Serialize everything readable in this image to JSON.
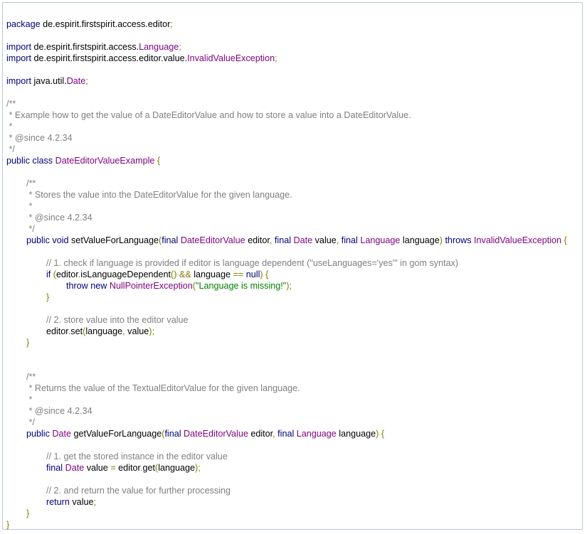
{
  "code_lines": [
    [
      [
        "kw",
        "package"
      ],
      [
        "pl",
        " de.espirit.firstspirit.access.editor"
      ],
      [
        "op",
        ";"
      ]
    ],
    [],
    [
      [
        "kw",
        "import"
      ],
      [
        "pl",
        " de.espirit.firstspirit.access."
      ],
      [
        "ty",
        "Language"
      ],
      [
        "op",
        ";"
      ]
    ],
    [
      [
        "kw",
        "import"
      ],
      [
        "pl",
        " de.espirit.firstspirit.access.editor.value."
      ],
      [
        "ty",
        "InvalidValueException"
      ],
      [
        "op",
        ";"
      ]
    ],
    [],
    [
      [
        "kw",
        "import"
      ],
      [
        "pl",
        " java.util."
      ],
      [
        "ty",
        "Date"
      ],
      [
        "op",
        ";"
      ]
    ],
    [],
    [
      [
        "cm",
        "/**"
      ]
    ],
    [
      [
        "cm",
        " * Example how to get the value of a DateEditorValue and how to store a value into a DateEditorValue."
      ]
    ],
    [
      [
        "cm",
        " *"
      ]
    ],
    [
      [
        "cm",
        " * @since 4.2.34"
      ]
    ],
    [
      [
        "cm",
        " */"
      ]
    ],
    [
      [
        "kw",
        "public class"
      ],
      [
        "pl",
        " "
      ],
      [
        "ty",
        "DateEditorValueExample"
      ],
      [
        "op",
        " {"
      ]
    ],
    [],
    [
      [
        "pl",
        "        "
      ],
      [
        "cm",
        "/**"
      ]
    ],
    [
      [
        "pl",
        "        "
      ],
      [
        "cm",
        " * Stores the value into the DateEditorValue for the given language."
      ]
    ],
    [
      [
        "pl",
        "        "
      ],
      [
        "cm",
        " *"
      ]
    ],
    [
      [
        "pl",
        "        "
      ],
      [
        "cm",
        " * @since 4.2.34"
      ]
    ],
    [
      [
        "pl",
        "        "
      ],
      [
        "cm",
        " */"
      ]
    ],
    [
      [
        "pl",
        "        "
      ],
      [
        "kw",
        "public void"
      ],
      [
        "pl",
        " setValueForLanguage"
      ],
      [
        "op",
        "("
      ],
      [
        "kw",
        "final"
      ],
      [
        "pl",
        " "
      ],
      [
        "ty",
        "DateEditorValue"
      ],
      [
        "pl",
        " editor"
      ],
      [
        "op",
        ", "
      ],
      [
        "kw",
        "final"
      ],
      [
        "pl",
        " "
      ],
      [
        "ty",
        "Date"
      ],
      [
        "pl",
        " value"
      ],
      [
        "op",
        ", "
      ],
      [
        "kw",
        "final"
      ],
      [
        "pl",
        " "
      ],
      [
        "ty",
        "Language"
      ],
      [
        "pl",
        " language"
      ],
      [
        "op",
        ") "
      ],
      [
        "kw",
        "throws"
      ],
      [
        "pl",
        " "
      ],
      [
        "ty",
        "InvalidValueException"
      ],
      [
        "op",
        " {"
      ]
    ],
    [],
    [
      [
        "pl",
        "                "
      ],
      [
        "cm",
        "// 1. check if language is provided if editor is language dependent (\"useLanguages='yes'\" in gom syntax)"
      ]
    ],
    [
      [
        "pl",
        "                "
      ],
      [
        "kw",
        "if"
      ],
      [
        "op",
        " ("
      ],
      [
        "pl",
        "editor"
      ],
      [
        "op",
        "."
      ],
      [
        "pl",
        "isLanguageDependent"
      ],
      [
        "op",
        "() && "
      ],
      [
        "pl",
        "language "
      ],
      [
        "op",
        "== "
      ],
      [
        "kw",
        "null"
      ],
      [
        "op",
        ") {"
      ]
    ],
    [
      [
        "pl",
        "                        "
      ],
      [
        "kw",
        "throw new"
      ],
      [
        "pl",
        " "
      ],
      [
        "ty",
        "NullPointerException"
      ],
      [
        "op",
        "("
      ],
      [
        "st",
        "\"Language is missing!\""
      ],
      [
        "op",
        ");"
      ]
    ],
    [
      [
        "pl",
        "                "
      ],
      [
        "op",
        "}"
      ]
    ],
    [],
    [
      [
        "pl",
        "                "
      ],
      [
        "cm",
        "// 2. store value into the editor value"
      ]
    ],
    [
      [
        "pl",
        "                editor"
      ],
      [
        "op",
        "."
      ],
      [
        "pl",
        "set"
      ],
      [
        "op",
        "("
      ],
      [
        "pl",
        "language"
      ],
      [
        "op",
        ", "
      ],
      [
        "pl",
        "value"
      ],
      [
        "op",
        ");"
      ]
    ],
    [
      [
        "pl",
        "        "
      ],
      [
        "op",
        "}"
      ]
    ],
    [],
    [],
    [
      [
        "pl",
        "        "
      ],
      [
        "cm",
        "/**"
      ]
    ],
    [
      [
        "pl",
        "        "
      ],
      [
        "cm",
        " * Returns the value of the TextualEditorValue for the given language."
      ]
    ],
    [
      [
        "pl",
        "        "
      ],
      [
        "cm",
        " *"
      ]
    ],
    [
      [
        "pl",
        "        "
      ],
      [
        "cm",
        " * @since 4.2.34"
      ]
    ],
    [
      [
        "pl",
        "        "
      ],
      [
        "cm",
        " */"
      ]
    ],
    [
      [
        "pl",
        "        "
      ],
      [
        "kw",
        "public"
      ],
      [
        "pl",
        " "
      ],
      [
        "ty",
        "Date"
      ],
      [
        "pl",
        " getValueForLanguage"
      ],
      [
        "op",
        "("
      ],
      [
        "kw",
        "final"
      ],
      [
        "pl",
        " "
      ],
      [
        "ty",
        "DateEditorValue"
      ],
      [
        "pl",
        " editor"
      ],
      [
        "op",
        ", "
      ],
      [
        "kw",
        "final"
      ],
      [
        "pl",
        " "
      ],
      [
        "ty",
        "Language"
      ],
      [
        "pl",
        " language"
      ],
      [
        "op",
        ") {"
      ]
    ],
    [],
    [
      [
        "pl",
        "                "
      ],
      [
        "cm",
        "// 1. get the stored instance in the editor value"
      ]
    ],
    [
      [
        "pl",
        "                "
      ],
      [
        "kw",
        "final"
      ],
      [
        "pl",
        " "
      ],
      [
        "ty",
        "Date"
      ],
      [
        "pl",
        " value "
      ],
      [
        "op",
        "= "
      ],
      [
        "pl",
        "editor"
      ],
      [
        "op",
        "."
      ],
      [
        "pl",
        "get"
      ],
      [
        "op",
        "("
      ],
      [
        "pl",
        "language"
      ],
      [
        "op",
        ");"
      ]
    ],
    [],
    [
      [
        "pl",
        "                "
      ],
      [
        "cm",
        "// 2. and return the value for further processing"
      ]
    ],
    [
      [
        "pl",
        "                "
      ],
      [
        "kw",
        "return"
      ],
      [
        "pl",
        " value"
      ],
      [
        "op",
        ";"
      ]
    ],
    [
      [
        "pl",
        "        "
      ],
      [
        "op",
        "}"
      ]
    ],
    [
      [
        "op",
        "}"
      ]
    ]
  ]
}
